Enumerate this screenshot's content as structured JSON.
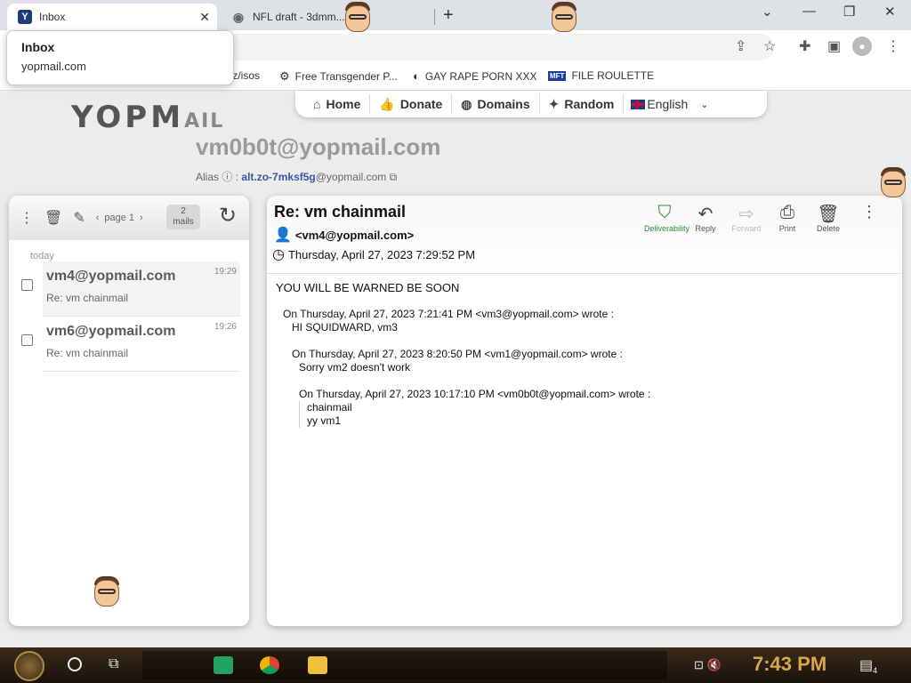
{
  "browser": {
    "tabs": [
      {
        "title": "Inbox",
        "favicon": "Y"
      },
      {
        "title": "NFL draft - 3dmm..."
      }
    ],
    "popup": {
      "title": "Inbox",
      "subtitle": "yopmail.com"
    },
    "bookmarks": [
      {
        "label": "tz/isos"
      },
      {
        "label": "Free Transgender P..."
      },
      {
        "label": "GAY RAPE PORN XXX"
      },
      {
        "label": "FILE ROULETTE",
        "icon": "MFT"
      }
    ]
  },
  "site": {
    "logo": "YOPMAIL",
    "nav": [
      {
        "label": "Home",
        "icon": "home-icon"
      },
      {
        "label": "Donate",
        "icon": "thumbs-up-icon"
      },
      {
        "label": "Domains",
        "icon": "globe-icon"
      },
      {
        "label": "Random",
        "icon": "magic-wand-icon"
      }
    ],
    "language": "English",
    "mailbox": "vm0b0t@yopmail.com",
    "alias_label": "Alias",
    "alias_value": "alt.zo-7mksf5g",
    "alias_domain": "@yopmail.com"
  },
  "inbox": {
    "page": "page 1",
    "count_num": "2",
    "count_label": "mails",
    "group": "today",
    "mails": [
      {
        "from": "vm4@yopmail.com",
        "subject": "Re: vm chainmail",
        "time": "19:29",
        "selected": true
      },
      {
        "from": "vm6@yopmail.com",
        "subject": "Re: vm chainmail",
        "time": "19:26",
        "selected": false
      }
    ]
  },
  "message": {
    "subject": "Re: vm chainmail",
    "from": "<vm4@yopmail.com>",
    "date": "Thursday, April 27, 2023 7:29:52 PM",
    "actions": [
      {
        "label": "Deliverability",
        "icon": "shield-check-icon",
        "state": "green"
      },
      {
        "label": "Reply",
        "icon": "reply-icon",
        "state": "normal"
      },
      {
        "label": "Forward",
        "icon": "forward-icon",
        "state": "disabled"
      },
      {
        "label": "Print",
        "icon": "print-icon",
        "state": "normal"
      },
      {
        "label": "Delete",
        "icon": "trash-icon",
        "state": "normal"
      }
    ],
    "body": {
      "line1": "YOU WILL BE WARNED BE SOON",
      "q1_head": "On Thursday, April 27, 2023 7:21:41 PM <vm3@yopmail.com> wrote :",
      "q1_text": "HI SQUIDWARD, vm3",
      "q2_head": "On Thursday, April 27, 2023 8:20:50 PM <vm1@yopmail.com> wrote :",
      "q2_text": "Sorry vm2 doesn't work",
      "q3_head": "On Thursday, April 27, 2023 10:17:10 PM <vm0b0t@yopmail.com> wrote :",
      "q3_text1": "chainmail",
      "q3_text2": "yy vm1"
    }
  },
  "taskbar": {
    "clock": "7:43 PM",
    "notifications": "4"
  }
}
